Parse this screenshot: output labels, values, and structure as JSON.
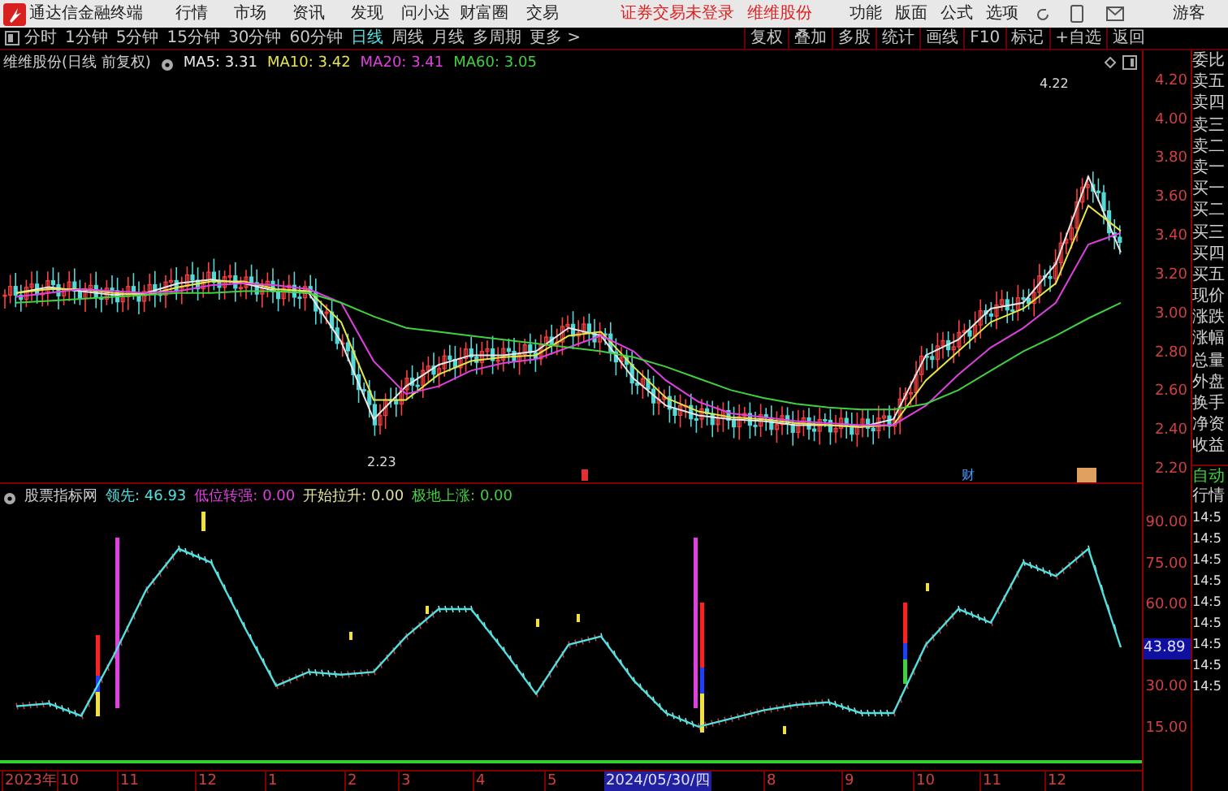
{
  "app_bar": {
    "title": "通达信金融终端",
    "menus": [
      "行情",
      "市场",
      "资讯",
      "发现",
      "问小达",
      "财富圈",
      "交易"
    ],
    "notices": [
      "证券交易未登录",
      "维维股份"
    ],
    "right_menus": [
      "功能",
      "版面",
      "公式",
      "选项"
    ],
    "user": "游客"
  },
  "periods": [
    {
      "label": "分时",
      "selected": false
    },
    {
      "label": "1分钟",
      "selected": false
    },
    {
      "label": "5分钟",
      "selected": false
    },
    {
      "label": "15分钟",
      "selected": false
    },
    {
      "label": "30分钟",
      "selected": false
    },
    {
      "label": "60分钟",
      "selected": false
    },
    {
      "label": "日线",
      "selected": true
    },
    {
      "label": "周线",
      "selected": false
    },
    {
      "label": "月线",
      "selected": false
    },
    {
      "label": "多周期",
      "selected": false
    },
    {
      "label": "更多 >",
      "selected": false
    }
  ],
  "tools": [
    "复权",
    "叠加",
    "多股",
    "统计",
    "画线",
    "F10",
    "标记",
    "+自选",
    "返回"
  ],
  "price_chart": {
    "title": "维维股份(日线 前复权)",
    "high_label": "4.22",
    "low_label": "2.23",
    "marker": "财",
    "chart_data": {
      "type": "line",
      "ylim": [
        2.2,
        4.35
      ],
      "yticks": [
        {
          "value": 4.2,
          "label": "4.20"
        },
        {
          "value": 4.0,
          "label": "4.00"
        },
        {
          "value": 3.8,
          "label": "3.80"
        },
        {
          "value": 3.6,
          "label": "3.60"
        },
        {
          "value": 3.4,
          "label": "3.40"
        },
        {
          "value": 3.2,
          "label": "3.20"
        },
        {
          "value": 3.0,
          "label": "3.00"
        },
        {
          "value": 2.8,
          "label": "2.80"
        },
        {
          "value": 2.6,
          "label": "2.60"
        },
        {
          "value": 2.4,
          "label": "2.40"
        },
        {
          "value": 2.2,
          "label": "2.20"
        }
      ],
      "series": [
        {
          "name": "MA5: 3.31",
          "color": "#e8e8e8",
          "values": [
            3.1,
            3.13,
            3.11,
            3.09,
            3.1,
            3.15,
            3.17,
            3.15,
            3.11,
            3.1,
            2.85,
            2.45,
            2.62,
            2.73,
            2.78,
            2.78,
            2.8,
            2.92,
            2.88,
            2.66,
            2.52,
            2.47,
            2.45,
            2.44,
            2.42,
            2.42,
            2.41,
            2.45,
            2.78,
            2.86,
            3.02,
            3.05,
            3.25,
            3.7,
            3.31
          ]
        },
        {
          "name": "MA10: 3.42",
          "color": "#e6e64a",
          "values": [
            3.1,
            3.12,
            3.12,
            3.1,
            3.09,
            3.13,
            3.16,
            3.16,
            3.12,
            3.11,
            2.95,
            2.55,
            2.55,
            2.68,
            2.75,
            2.77,
            2.78,
            2.88,
            2.9,
            2.72,
            2.56,
            2.49,
            2.46,
            2.45,
            2.43,
            2.42,
            2.41,
            2.42,
            2.65,
            2.8,
            2.95,
            3.02,
            3.15,
            3.55,
            3.42
          ]
        },
        {
          "name": "MA20: 3.41",
          "color": "#e040e0",
          "values": [
            3.08,
            3.1,
            3.12,
            3.11,
            3.1,
            3.11,
            3.14,
            3.15,
            3.14,
            3.12,
            3.05,
            2.75,
            2.58,
            2.62,
            2.7,
            2.74,
            2.76,
            2.82,
            2.88,
            2.8,
            2.65,
            2.54,
            2.48,
            2.46,
            2.44,
            2.43,
            2.42,
            2.42,
            2.52,
            2.68,
            2.82,
            2.92,
            3.05,
            3.35,
            3.41
          ]
        },
        {
          "name": "MA60: 3.05",
          "color": "#40d040",
          "values": [
            3.05,
            3.06,
            3.07,
            3.08,
            3.09,
            3.1,
            3.1,
            3.11,
            3.11,
            3.1,
            3.05,
            2.98,
            2.92,
            2.9,
            2.88,
            2.86,
            2.84,
            2.82,
            2.8,
            2.77,
            2.72,
            2.66,
            2.6,
            2.56,
            2.53,
            2.51,
            2.5,
            2.5,
            2.53,
            2.6,
            2.7,
            2.8,
            2.88,
            2.97,
            3.05
          ]
        }
      ]
    }
  },
  "indicator": {
    "title": "股票指标网",
    "legend": [
      {
        "text": "低位转强: 0.00",
        "color": "#e040e0"
      },
      {
        "text": "开始拉升: 0.00",
        "color": "#e0e0a0"
      },
      {
        "text": "极地上涨: 0.00",
        "color": "#40d040"
      }
    ],
    "current": "43.89",
    "chart_data": {
      "type": "line",
      "ylim": [
        -6.68,
        90
      ],
      "yticks": [
        {
          "value": 90,
          "label": "90.00"
        },
        {
          "value": 75,
          "label": "75.00"
        },
        {
          "value": 60,
          "label": "60.00"
        },
        {
          "value": 30,
          "label": "30.00"
        },
        {
          "value": 15,
          "label": "15.00"
        }
      ],
      "series": [
        {
          "name": "领先: 46.93",
          "color": "#50e0e0",
          "values": [
            22.5,
            23.5,
            19,
            41,
            65,
            80,
            75,
            52,
            30,
            35,
            34,
            35,
            48,
            58,
            58,
            43,
            27,
            45,
            48,
            32,
            20,
            15,
            18,
            21,
            23,
            24,
            20,
            20,
            45,
            58,
            53,
            75,
            70,
            80,
            44
          ]
        }
      ]
    }
  },
  "x_axis": [
    {
      "label": "2023年",
      "selected": false
    },
    {
      "label": "10",
      "selected": false
    },
    {
      "label": "11",
      "selected": false
    },
    {
      "label": "12",
      "selected": false
    },
    {
      "label": "1",
      "selected": false
    },
    {
      "label": "2",
      "selected": false
    },
    {
      "label": "3",
      "selected": false
    },
    {
      "label": "4",
      "selected": false
    },
    {
      "label": "5",
      "selected": false
    },
    {
      "label": "2024/05/30/四",
      "selected": true
    },
    {
      "label": "8",
      "selected": false
    },
    {
      "label": "9",
      "selected": false
    },
    {
      "label": "10",
      "selected": false
    },
    {
      "label": "11",
      "selected": false
    },
    {
      "label": "12",
      "selected": false
    }
  ],
  "quote_panel": [
    "委比",
    "卖五",
    "卖四",
    "卖三",
    "卖二",
    "卖一",
    "买一",
    "买二",
    "买三",
    "买四",
    "买五",
    "现价",
    "涨跌",
    "涨幅",
    "总量",
    "外盘",
    "换手",
    "净资",
    "收益"
  ],
  "quote_panel_lower": [
    {
      "text": "自动",
      "kind": "mode"
    },
    {
      "text": "行情",
      "kind": "label"
    },
    {
      "text": "14:5",
      "kind": "time"
    },
    {
      "text": "14:5",
      "kind": "time"
    },
    {
      "text": "14:5",
      "kind": "time"
    },
    {
      "text": "14:5",
      "kind": "time"
    },
    {
      "text": "14:5",
      "kind": "time"
    },
    {
      "text": "14:5",
      "kind": "time"
    },
    {
      "text": "14:5",
      "kind": "time"
    },
    {
      "text": "14:5",
      "kind": "time"
    },
    {
      "text": "14:5",
      "kind": "time"
    }
  ]
}
